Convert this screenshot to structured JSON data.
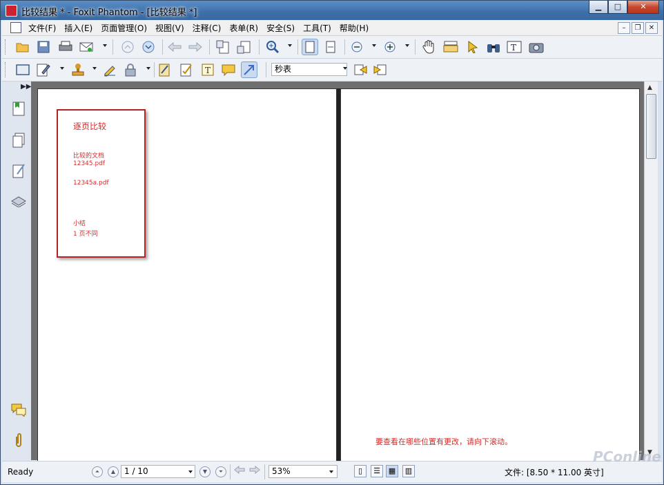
{
  "window": {
    "title": "比较结果 * - Foxit Phantom - [比较结果 *]",
    "minimize": "▁",
    "maximize": "□",
    "close": "✕"
  },
  "menubar": {
    "items": [
      "文件(F)",
      "插入(E)",
      "页面管理(O)",
      "视图(V)",
      "注释(C)",
      "表单(R)",
      "安全(S)",
      "工具(T)",
      "帮助(H)"
    ],
    "mdi_minimize": "–",
    "mdi_restore": "❐",
    "mdi_close": "✕"
  },
  "toolbar2": {
    "font_value": "秒表"
  },
  "left_page": {
    "title": "逐页比较",
    "compared_docs_label": "比较的文档",
    "doc1": "12345.pdf",
    "doc2": "12345a.pdf",
    "summary_label": "小结",
    "summary_value": "1  页不同"
  },
  "right_page": {
    "hint": "要查看在哪些位置有更改，请向下滚动。"
  },
  "statusbar": {
    "ready": "Ready",
    "page_value": "1 / 10",
    "zoom_value": "53%",
    "file_info": "文件: [8.50 * 11.00 英寸]"
  },
  "watermark": "PConline"
}
